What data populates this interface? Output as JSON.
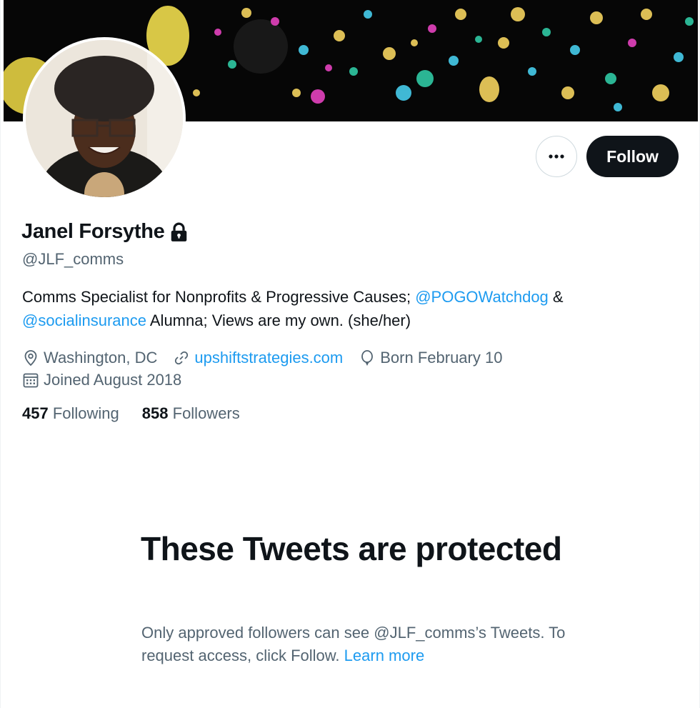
{
  "profile": {
    "name": "Janel Forsythe",
    "handle": "@JLF_comms",
    "bio": {
      "part1": "Comms Specialist for Nonprofits & Progressive Causes; ",
      "mention1": "@POGOWatchdog",
      "part2": " & ",
      "mention2": "@socialinsurance",
      "part3": " Alumna; Views are my own. (she/her)"
    },
    "location": "Washington, DC",
    "website": "upshiftstrategies.com",
    "birthday": "Born February 10",
    "joined": "Joined August 2018",
    "following_count": "457",
    "following_label": "Following",
    "followers_count": "858",
    "followers_label": "Followers"
  },
  "actions": {
    "more_icon": "more-dots-icon",
    "follow_label": "Follow"
  },
  "protected": {
    "title": "These Tweets are protected",
    "text": "Only approved followers can see @JLF_comms’s Tweets. To request access, click Follow. ",
    "learn_more": "Learn more"
  },
  "icons": {
    "lock": "lock-icon",
    "location": "location-pin-icon",
    "link": "link-icon",
    "birthday": "balloon-icon",
    "calendar": "calendar-icon"
  },
  "colors": {
    "text": "#0f1419",
    "secondary": "#536471",
    "link": "#1d9bf0",
    "follow_bg": "#0f1419"
  }
}
